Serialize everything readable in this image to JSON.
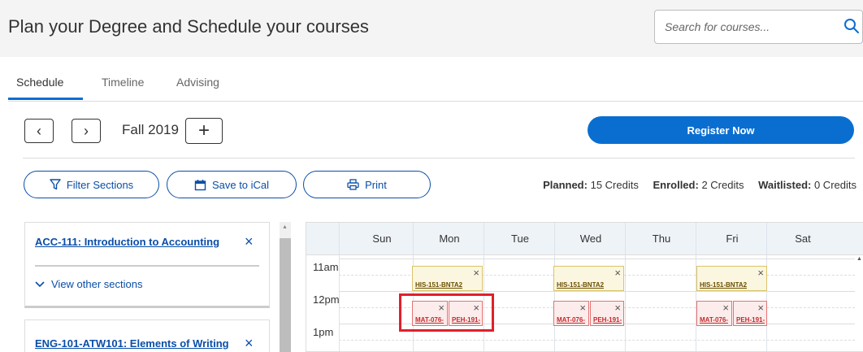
{
  "header": {
    "title": "Plan your Degree and Schedule your courses",
    "search_placeholder": "Search for courses..."
  },
  "tabs": [
    {
      "label": "Schedule",
      "active": true
    },
    {
      "label": "Timeline",
      "active": false
    },
    {
      "label": "Advising",
      "active": false
    }
  ],
  "term": {
    "prev_glyph": "‹",
    "next_glyph": "›",
    "label": "Fall 2019",
    "add_glyph": "+"
  },
  "actions": {
    "register": "Register Now",
    "filter": "Filter Sections",
    "ical": "Save to iCal",
    "print": "Print"
  },
  "credits": {
    "planned_label": "Planned:",
    "planned_value": "15 Credits",
    "enrolled_label": "Enrolled:",
    "enrolled_value": "2 Credits",
    "waitlisted_label": "Waitlisted:",
    "waitlisted_value": "0 Credits"
  },
  "courses": [
    {
      "title": "ACC-111: Introduction to Accounting",
      "view_other": "View other sections"
    },
    {
      "title": "ENG-101-ATW101: Elements of Writing"
    }
  ],
  "calendar": {
    "days": [
      "Sun",
      "Mon",
      "Tue",
      "Wed",
      "Thu",
      "Fri",
      "Sat"
    ],
    "times": [
      "11am",
      "12pm",
      "1pm"
    ],
    "events": [
      {
        "day": "Mon",
        "label": "HIS-151-BNTA2",
        "color": "yellow"
      },
      {
        "day": "Wed",
        "label": "HIS-151-BNTA2",
        "color": "yellow"
      },
      {
        "day": "Fri",
        "label": "HIS-151-BNTA2",
        "color": "yellow"
      },
      {
        "day": "Mon",
        "label": "MAT-076-",
        "color": "red"
      },
      {
        "day": "Mon",
        "label": "PEH-191-",
        "color": "red"
      },
      {
        "day": "Wed",
        "label": "MAT-076-",
        "color": "red"
      },
      {
        "day": "Wed",
        "label": "PEH-191-",
        "color": "red"
      },
      {
        "day": "Fri",
        "label": "MAT-076-",
        "color": "red"
      },
      {
        "day": "Fri",
        "label": "PEH-191-",
        "color": "red"
      }
    ],
    "close_glyph": "×"
  },
  "colors": {
    "accent": "#0a6ed1",
    "link": "#0a4ea8",
    "highlight": "#e0202a"
  }
}
